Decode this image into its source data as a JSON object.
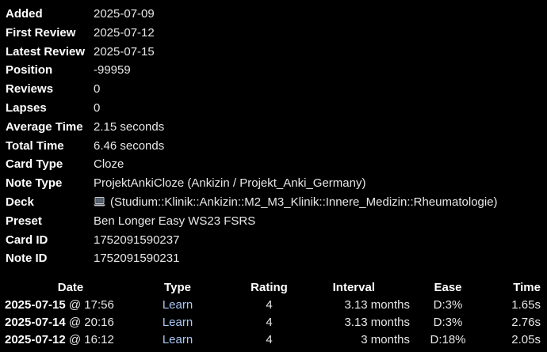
{
  "card_info": [
    {
      "label": "Added",
      "value": "2025-07-09"
    },
    {
      "label": "First Review",
      "value": "2025-07-12"
    },
    {
      "label": "Latest Review",
      "value": "2025-07-15"
    },
    {
      "label": "Position",
      "value": "-99959"
    },
    {
      "label": "Reviews",
      "value": "0"
    },
    {
      "label": "Lapses",
      "value": "0"
    },
    {
      "label": "Average Time",
      "value": "2.15 seconds"
    },
    {
      "label": "Total Time",
      "value": "6.46 seconds"
    },
    {
      "label": "Card Type",
      "value": "Cloze"
    },
    {
      "label": "Note Type",
      "value": "ProjektAnkiCloze (Ankizin / Projekt_Anki_Germany)"
    },
    {
      "label": "Deck",
      "value": "(Studium::Klinik::Ankizin::M2_M3_Klinik::Innere_Medizin::Rheumatologie)",
      "icon": "laptop-icon"
    },
    {
      "label": "Preset",
      "value": "Ben Longer Easy WS23 FSRS"
    },
    {
      "label": "Card ID",
      "value": "1752091590237"
    },
    {
      "label": "Note ID",
      "value": "1752091590231"
    }
  ],
  "revlog": {
    "headers": {
      "date": "Date",
      "type": "Type",
      "rating": "Rating",
      "interval": "Interval",
      "ease": "Ease",
      "time": "Time"
    },
    "rows": [
      {
        "date": "2025-07-15",
        "at": " @ 17:56",
        "type": "Learn",
        "rating": "4",
        "interval": "3.13 months",
        "ease": "D:3%",
        "time": "1.65s"
      },
      {
        "date": "2025-07-14",
        "at": " @ 20:16",
        "type": "Learn",
        "rating": "4",
        "interval": "3.13 months",
        "ease": "D:3%",
        "time": "2.76s"
      },
      {
        "date": "2025-07-12",
        "at": " @ 16:12",
        "type": "Learn",
        "rating": "4",
        "interval": "3 months",
        "ease": "D:18%",
        "time": "2.05s"
      }
    ]
  },
  "colors": {
    "background": "#000000",
    "text": "#ffffff",
    "learn_link": "#a9c8f5"
  }
}
